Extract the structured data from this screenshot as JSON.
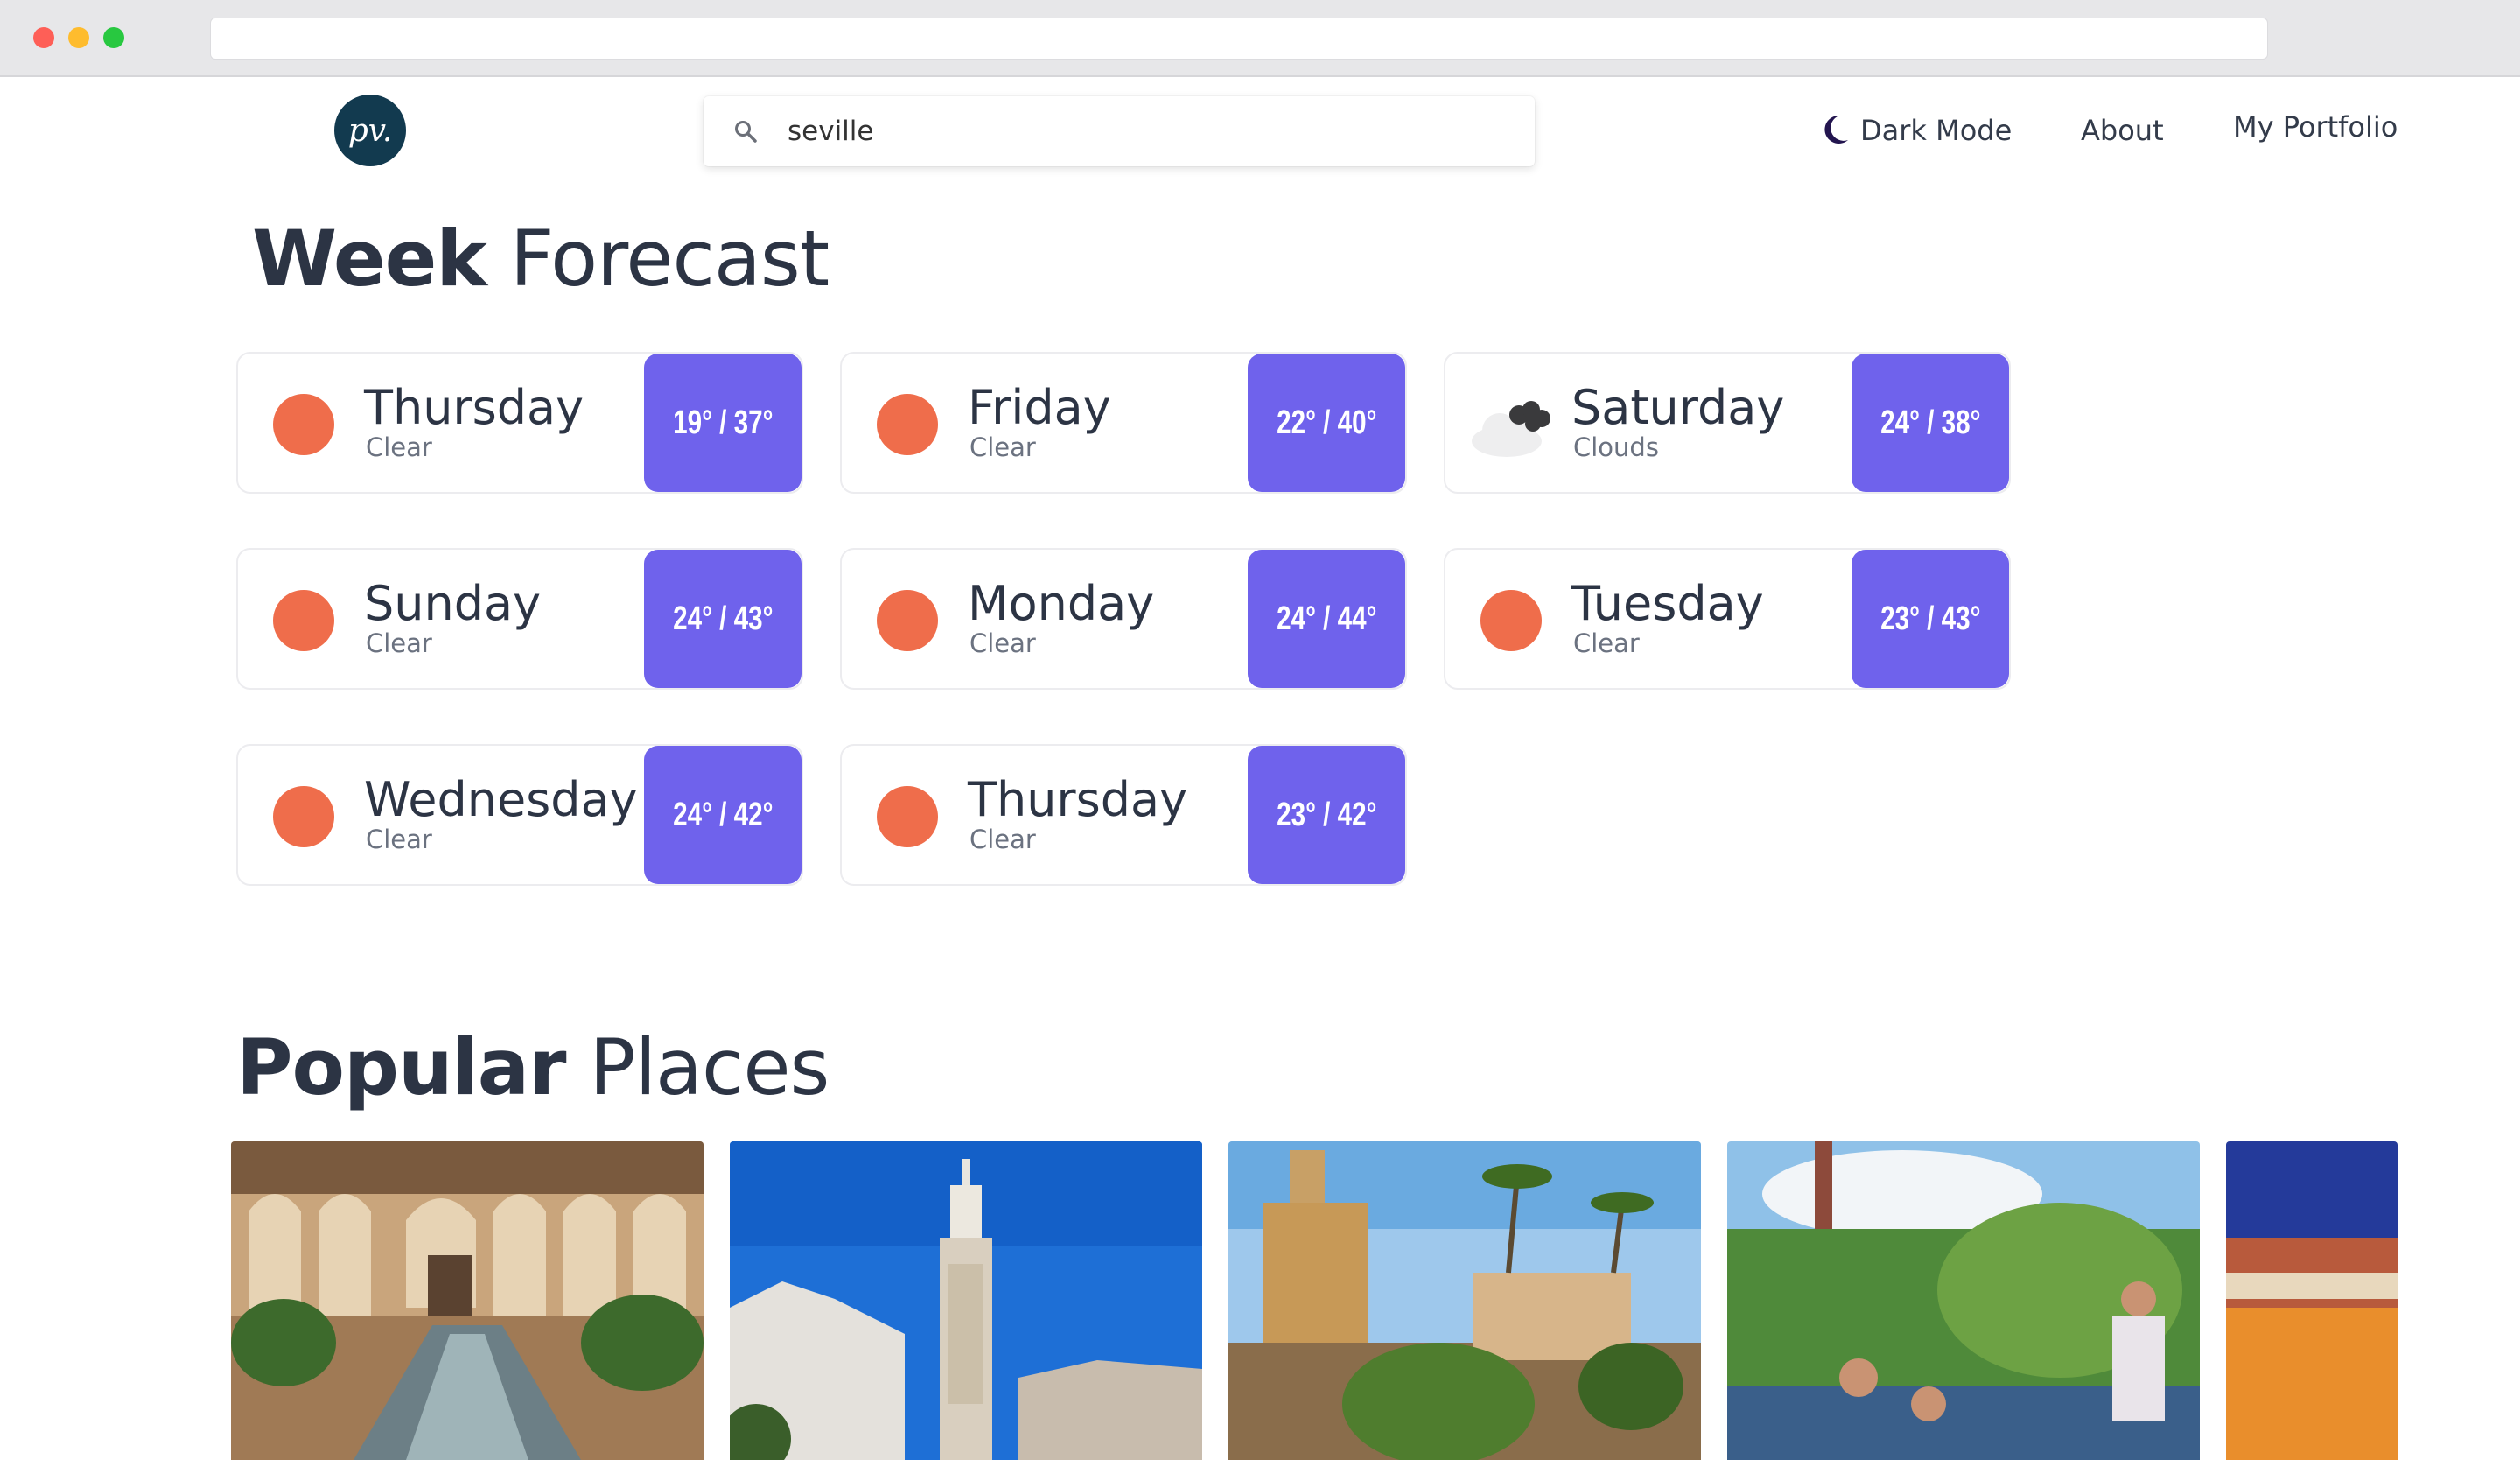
{
  "search": {
    "value": "seville",
    "icon": "search-icon"
  },
  "logo": {
    "text": "pv."
  },
  "nav": {
    "dark_mode": "Dark Mode",
    "about": "About",
    "portfolio": "My Portfolio"
  },
  "forecast": {
    "title_bold": "Week",
    "title_rest": "Forecast",
    "days": [
      {
        "day": "Thursday",
        "desc": "Clear",
        "temp": "19° / 37°",
        "icon": "sun-icon"
      },
      {
        "day": "Friday",
        "desc": "Clear",
        "temp": "22° / 40°",
        "icon": "sun-icon"
      },
      {
        "day": "Saturday",
        "desc": "Clouds",
        "temp": "24° / 38°",
        "icon": "cloud-icon"
      },
      {
        "day": "Sunday",
        "desc": "Clear",
        "temp": "24° / 43°",
        "icon": "sun-icon"
      },
      {
        "day": "Monday",
        "desc": "Clear",
        "temp": "24° / 44°",
        "icon": "sun-icon"
      },
      {
        "day": "Tuesday",
        "desc": "Clear",
        "temp": "23° / 43°",
        "icon": "sun-icon"
      },
      {
        "day": "Wednesday",
        "desc": "Clear",
        "temp": "24° / 42°",
        "icon": "sun-icon"
      },
      {
        "day": "Thursday",
        "desc": "Clear",
        "temp": "23° / 42°",
        "icon": "sun-icon"
      }
    ]
  },
  "places": {
    "title_bold": "Popular",
    "title_rest": "Places"
  },
  "colors": {
    "accent": "#6f62ec",
    "sun": "#ef6d4b",
    "logo_bg": "#123a4f",
    "text": "#2c3444"
  }
}
